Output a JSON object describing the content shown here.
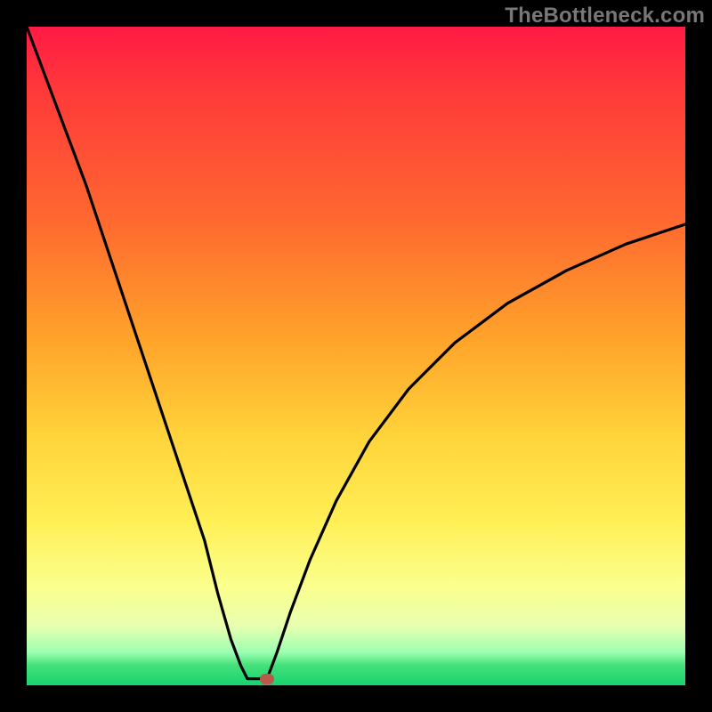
{
  "watermark": {
    "text": "TheBottleneck.com"
  },
  "chart_data": {
    "type": "line",
    "title": "",
    "xlabel": "",
    "ylabel": "",
    "xlim": [
      0,
      100
    ],
    "ylim": [
      0,
      100
    ],
    "grid": false,
    "legend": false,
    "background_gradient": {
      "orientation": "vertical",
      "stops": [
        {
          "pos": 0,
          "color": "#ff1a44"
        },
        {
          "pos": 30,
          "color": "#ff6a2f"
        },
        {
          "pos": 60,
          "color": "#ffd33a"
        },
        {
          "pos": 85,
          "color": "#fbff8d"
        },
        {
          "pos": 97,
          "color": "#43e07a"
        },
        {
          "pos": 100,
          "color": "#17d36e"
        }
      ]
    },
    "series": [
      {
        "name": "left-branch",
        "type": "line",
        "color": "#000000",
        "x": [
          0,
          3,
          6,
          9,
          12,
          15,
          18,
          21,
          24,
          27,
          29,
          31,
          32.5,
          33.5
        ],
        "y": [
          100,
          92,
          84,
          76,
          67,
          58,
          49,
          40,
          31,
          22,
          14,
          7,
          3,
          1
        ]
      },
      {
        "name": "valley-floor",
        "type": "line",
        "color": "#000000",
        "x": [
          33.5,
          36.5
        ],
        "y": [
          1,
          1
        ]
      },
      {
        "name": "right-branch",
        "type": "line",
        "color": "#000000",
        "x": [
          36.5,
          38,
          40,
          43,
          47,
          52,
          58,
          65,
          73,
          82,
          91,
          100
        ],
        "y": [
          1,
          5,
          11,
          19,
          28,
          37,
          45,
          52,
          58,
          63,
          67,
          70
        ]
      }
    ],
    "marker": {
      "name": "bottleneck-point",
      "x": 36.5,
      "y": 1,
      "color": "#b85a4a"
    }
  }
}
